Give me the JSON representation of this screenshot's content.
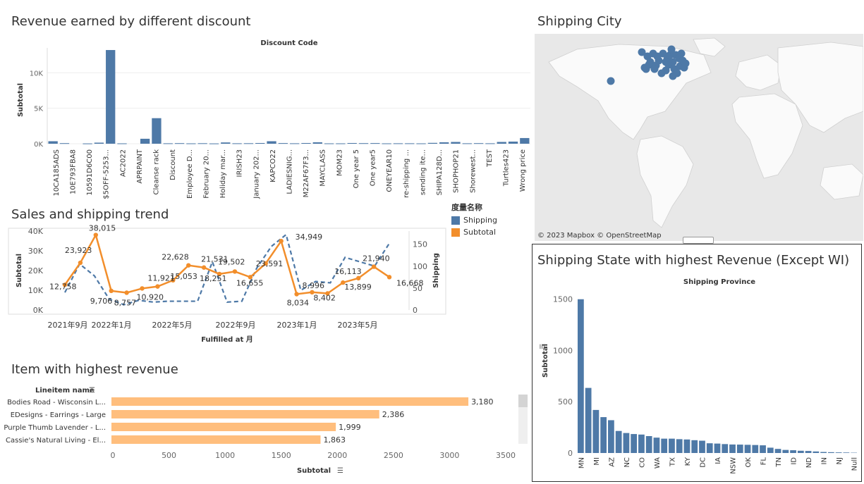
{
  "discount": {
    "title": "Revenue earned by different discount",
    "chart_data": {
      "type": "bar",
      "title": "Discount Code",
      "ylabel": "Subtotal",
      "ylim": [
        0,
        13500
      ],
      "yticks": [
        "0K",
        "5K",
        "10K"
      ],
      "categories": [
        "10CA185ADS",
        "10E793FBA8",
        "10591D6C00",
        "$5OFF-5253...",
        "AC2022",
        "APRPAINT",
        "Cleanse rack",
        "Discount",
        "Employee D...",
        "February 20...",
        "Holiday mar...",
        "IRISH23",
        "January 202...",
        "KAPCO22",
        "LADIESNIG...",
        "M22AF67F3...",
        "MAYCLASS",
        "MOM23",
        "One year 5",
        "One year5",
        "ONEYEAR10",
        "re-shipping ...",
        "sending ite...",
        "SHIPA128D...",
        "SHOPHOP21",
        "Shorewest...",
        "TEST",
        "Turtles423",
        "Wrong price"
      ],
      "bars": [
        {
          "x": 0,
          "v": 350
        },
        {
          "x": 1,
          "v": 80
        },
        {
          "x": 3,
          "v": 40
        },
        {
          "x": 4,
          "v": 150
        },
        {
          "x": 5,
          "v": 13200
        },
        {
          "x": 6,
          "v": 50
        },
        {
          "x": 8,
          "v": 700
        },
        {
          "x": 9,
          "v": 3600
        },
        {
          "x": 10,
          "v": 60
        },
        {
          "x": 11,
          "v": 80
        },
        {
          "x": 12,
          "v": 50
        },
        {
          "x": 13,
          "v": 70
        },
        {
          "x": 14,
          "v": 40
        },
        {
          "x": 15,
          "v": 180
        },
        {
          "x": 16,
          "v": 60
        },
        {
          "x": 17,
          "v": 70
        },
        {
          "x": 18,
          "v": 100
        },
        {
          "x": 19,
          "v": 350
        },
        {
          "x": 20,
          "v": 90
        },
        {
          "x": 21,
          "v": 60
        },
        {
          "x": 22,
          "v": 100
        },
        {
          "x": 23,
          "v": 200
        },
        {
          "x": 24,
          "v": 50
        },
        {
          "x": 25,
          "v": 50
        },
        {
          "x": 26,
          "v": 100
        },
        {
          "x": 27,
          "v": 80
        },
        {
          "x": 28,
          "v": 90
        },
        {
          "x": 29,
          "v": 50
        },
        {
          "x": 30,
          "v": 60
        },
        {
          "x": 31,
          "v": 60
        },
        {
          "x": 32,
          "v": 50
        },
        {
          "x": 33,
          "v": 120
        },
        {
          "x": 34,
          "v": 200
        },
        {
          "x": 35,
          "v": 250
        },
        {
          "x": 36,
          "v": 60
        },
        {
          "x": 37,
          "v": 80
        },
        {
          "x": 38,
          "v": 60
        },
        {
          "x": 39,
          "v": 250
        },
        {
          "x": 40,
          "v": 300
        },
        {
          "x": 41,
          "v": 800
        }
      ]
    }
  },
  "trend": {
    "title": "Sales and shipping trend",
    "chart_data": {
      "type": "line",
      "xlabel": "Fulfilled at 月",
      "ylabel": "Subtotal",
      "ylabel2": "Shipping",
      "xticks": [
        "2021年9月",
        "2022年1月",
        "2022年5月",
        "2022年9月",
        "2023年1月",
        "2023年5月"
      ],
      "yticks": [
        "0K",
        "10K",
        "20K",
        "30K",
        "40K"
      ],
      "yticks2": [
        "0",
        "50",
        "100",
        "150"
      ],
      "ylim": [
        0,
        40000
      ],
      "ylim2": [
        0,
        180
      ],
      "series": [
        {
          "name": "Subtotal",
          "color": "#f28e2b",
          "values": [
            12758,
            23923,
            38015,
            9706,
            8757,
            10920,
            11921,
            15053,
            22628,
            21531,
            18251,
            19502,
            16655,
            23591,
            34949,
            8034,
            8996,
            8402,
            13899,
            16113,
            21940,
            16668
          ]
        },
        {
          "name": "Shipping",
          "color": "#4e79a7",
          "values": [
            40,
            105,
            78,
            25,
            12,
            22,
            18,
            20,
            20,
            20,
            110,
            18,
            20,
            95,
            145,
            172,
            45,
            65,
            62,
            120,
            110,
            100,
            152
          ]
        }
      ],
      "labels": [
        "12,758",
        "23,923",
        "38,015",
        "9,706",
        "8,757",
        "10,920",
        "11,921",
        "15,053",
        "22,628",
        "21,531",
        "18,251",
        "19,502",
        "16,655",
        "23,591",
        "34,949",
        "8,034",
        "8,996",
        "8,402",
        "13,899",
        "16,113",
        "21,940",
        "16,668"
      ]
    },
    "legend": {
      "title": "度量名称",
      "items": [
        {
          "label": "Shipping",
          "color": "#4e79a7"
        },
        {
          "label": "Subtotal",
          "color": "#f28e2b"
        }
      ]
    }
  },
  "items": {
    "title": "Item with highest revenue",
    "chart_data": {
      "type": "bar",
      "orientation": "horizontal",
      "ylabel": "Lineitem name",
      "xlabel": "Subtotal",
      "xlim": [
        0,
        3600
      ],
      "xticks": [
        "0",
        "500",
        "1000",
        "1500",
        "2000",
        "2500",
        "3000",
        "3500"
      ],
      "categories": [
        "Bodies Road - Wisconsin L...",
        "EDesigns - Earrings - Large",
        "Purple Thumb Lavender - L...",
        "Cassie's Natural Living - El..."
      ],
      "values": [
        3180,
        2386,
        1999,
        1863
      ],
      "labels": [
        "3,180",
        "2,386",
        "1,999",
        "1,863"
      ],
      "color": "#ffbe7d"
    }
  },
  "city": {
    "title": "Shipping City",
    "attribution": "© 2023 Mapbox  © OpenStreetMap"
  },
  "state": {
    "title": "Shipping State with highest Revenue (Except WI)",
    "chart_data": {
      "type": "bar",
      "title": "Shipping Province",
      "ylabel": "Subtotal",
      "ylim": [
        0,
        1560
      ],
      "yticks": [
        "0",
        "500",
        "1000",
        "1500"
      ],
      "categories": [
        "MN",
        "",
        "MI",
        "",
        "AZ",
        "",
        "NC",
        "",
        "CO",
        "",
        "WA",
        "",
        "TX",
        "",
        "KY",
        "",
        "DC",
        "",
        "IA",
        "",
        "NSW",
        "",
        "OK",
        "",
        "FL",
        "",
        "TN",
        "",
        "ID",
        "",
        "ND",
        "",
        "IN",
        "",
        "NJ",
        "",
        "Null"
      ],
      "values": [
        1500,
        635,
        420,
        350,
        320,
        215,
        195,
        185,
        180,
        165,
        150,
        140,
        140,
        135,
        132,
        125,
        120,
        95,
        92,
        87,
        83,
        82,
        80,
        78,
        75,
        52,
        40,
        30,
        27,
        22,
        20,
        15,
        10,
        8,
        6,
        5,
        3
      ],
      "color": "#4e79a7"
    }
  }
}
